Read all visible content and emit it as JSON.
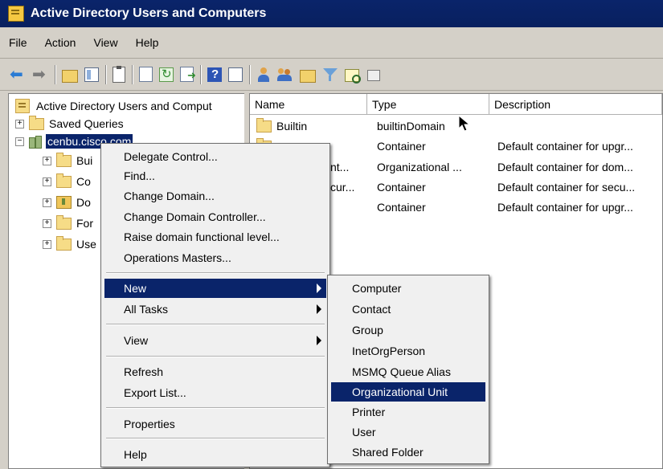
{
  "window": {
    "title": "Active Directory Users and Computers"
  },
  "menubar": [
    "File",
    "Action",
    "View",
    "Help"
  ],
  "toolbar": {
    "icons": [
      "back-arrow-icon",
      "forward-arrow-icon",
      "up-folder-icon",
      "show-hide-tree-icon",
      "clipboard-icon",
      "properties-icon",
      "refresh-icon",
      "export-list-icon",
      "help-icon",
      "view-icon",
      "new-user-icon",
      "new-group-icon",
      "new-ou-icon",
      "filter-icon",
      "find-icon",
      "add-to-group-icon"
    ]
  },
  "tree": {
    "root": "Active Directory Users and Comput",
    "saved_queries": "Saved Queries",
    "domain": "cenbu.cisco.com",
    "children": [
      "Bui",
      "Co",
      "Do",
      "For",
      "Use"
    ]
  },
  "list": {
    "columns": [
      "Name",
      "Type",
      "Description"
    ],
    "rows": [
      {
        "name": "Builtin",
        "type": "builtinDomain",
        "description": ""
      },
      {
        "name": "",
        "type": "Container",
        "description": "Default container for upgr..."
      },
      {
        "name": "nt...",
        "type": "Organizational ...",
        "description": "Default container for dom..."
      },
      {
        "name": "cur...",
        "type": "Container",
        "description": "Default container for secu..."
      },
      {
        "name": "",
        "type": "Container",
        "description": "Default container for upgr..."
      }
    ]
  },
  "context_menu": {
    "group1": [
      "Delegate Control...",
      "Find...",
      "Change Domain...",
      "Change Domain Controller...",
      "Raise domain functional level...",
      "Operations Masters..."
    ],
    "new": "New",
    "all_tasks": "All Tasks",
    "view": "View",
    "refresh": "Refresh",
    "export_list": "Export List...",
    "properties": "Properties",
    "help": "Help"
  },
  "submenu": [
    "Computer",
    "Contact",
    "Group",
    "InetOrgPerson",
    "MSMQ Queue Alias",
    "Organizational Unit",
    "Printer",
    "User",
    "Shared Folder"
  ],
  "colors": {
    "highlight": "#0a246a",
    "title": "#0a246a",
    "chrome": "#d4d0c8",
    "menu_bg": "#f0f0f0"
  }
}
